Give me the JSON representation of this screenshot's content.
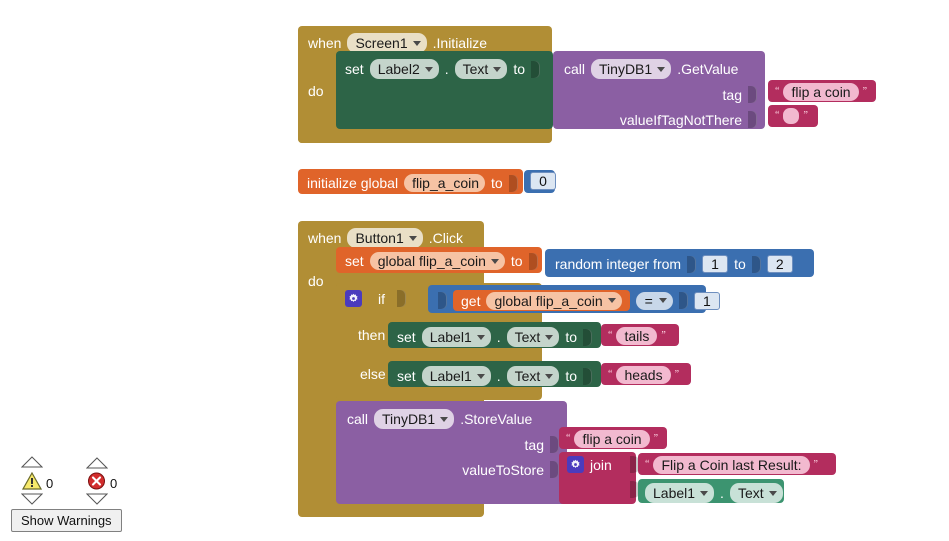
{
  "app": {
    "name": "MIT App Inventor Blocks Editor",
    "canvas_background": "#FFFFFF"
  },
  "colors": {
    "event_block": "#B18E35",
    "control_block": "#B18E35",
    "setter_block": "#2D6447",
    "getter_block": "#3C9470",
    "call_block": "#8B5FA3",
    "text_block": "#B32D5E",
    "variable_block": "#E0642A",
    "math_block": "#3B6FB0",
    "gear_icon": "#4B3BBD"
  },
  "blocks": {
    "screen_initialize": {
      "when_label": "when",
      "component": "Screen1",
      "event": ".Initialize",
      "do_label": "do",
      "statement": {
        "set_label": "set",
        "component": "Label2",
        "dot": ".",
        "property": "Text",
        "to_label": "to",
        "value": {
          "call_label": "call",
          "component": "TinyDB1",
          "method": ".GetValue",
          "args": [
            {
              "name": "tag",
              "value_type": "text",
              "value": "flip a coin"
            },
            {
              "name": "valueIfTagNotThere",
              "value_type": "text",
              "value": ""
            }
          ]
        }
      }
    },
    "init_global": {
      "label": "initialize global",
      "variable": "flip_a_coin",
      "to_label": "to",
      "value": "0"
    },
    "button_click": {
      "when_label": "when",
      "component": "Button1",
      "event": ".Click",
      "do_label": "do",
      "statements": [
        {
          "kind": "set_global",
          "set_label": "set",
          "variable": "global flip_a_coin",
          "to_label": "to",
          "value": {
            "kind": "random_integer",
            "label_from": "random integer from",
            "from": "1",
            "label_to": "to",
            "to": "2"
          }
        },
        {
          "kind": "if_else",
          "if_label": "if",
          "then_label": "then",
          "else_label": "else",
          "condition": {
            "get_label": "get",
            "variable": "global flip_a_coin",
            "operator": "=",
            "compare_to": "1"
          },
          "then_statement": {
            "set_label": "set",
            "component": "Label1",
            "dot": ".",
            "property": "Text",
            "to_label": "to",
            "text_value": "tails"
          },
          "else_statement": {
            "set_label": "set",
            "component": "Label1",
            "dot": ".",
            "property": "Text",
            "to_label": "to",
            "text_value": "heads"
          }
        },
        {
          "kind": "call_store",
          "call_label": "call",
          "component": "TinyDB1",
          "method": ".StoreValue",
          "args": [
            {
              "name": "tag",
              "value_type": "text",
              "value": "flip a coin"
            },
            {
              "name": "valueToStore",
              "value_type": "join",
              "join_label": "join",
              "items": [
                {
                  "type": "text",
                  "value": "Flip a Coin last Result:"
                },
                {
                  "type": "getter",
                  "component": "Label1",
                  "dot": ".",
                  "property": "Text"
                }
              ]
            }
          ]
        }
      ]
    }
  },
  "status_bar": {
    "warning_count": "0",
    "error_count": "0",
    "show_warnings_label": "Show Warnings",
    "warning_icon": "warning-triangle-icon",
    "error_icon": "error-circle-icon"
  }
}
